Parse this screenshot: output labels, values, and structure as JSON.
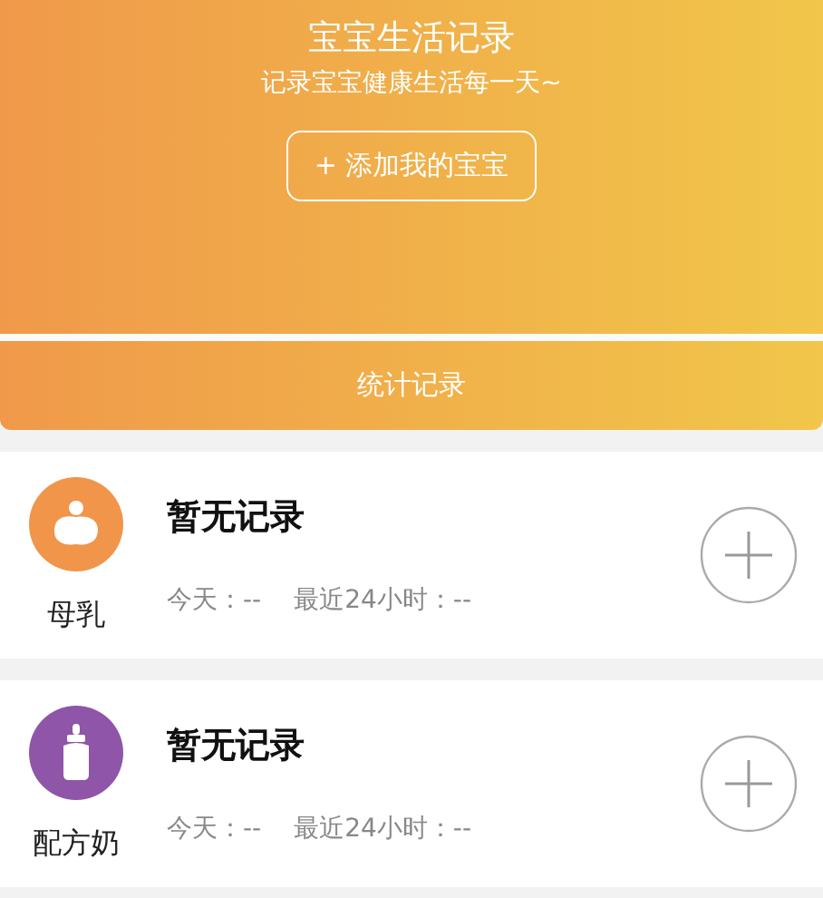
{
  "header": {
    "title": "宝宝生活记录",
    "subtitle": "记录宝宝健康生活每一天~",
    "add_button": "+ 添加我的宝宝"
  },
  "stats_button": "统计记录",
  "records": [
    {
      "kind": "breast",
      "color": "#f0954a",
      "name": "母乳",
      "status": "暂无记录",
      "today": "今天：--",
      "last24": "最近24小时：--"
    },
    {
      "kind": "bottle",
      "color": "#8e55a8",
      "name": "配方奶",
      "status": "暂无记录",
      "today": "今天：--",
      "last24": "最近24小时：--"
    }
  ]
}
